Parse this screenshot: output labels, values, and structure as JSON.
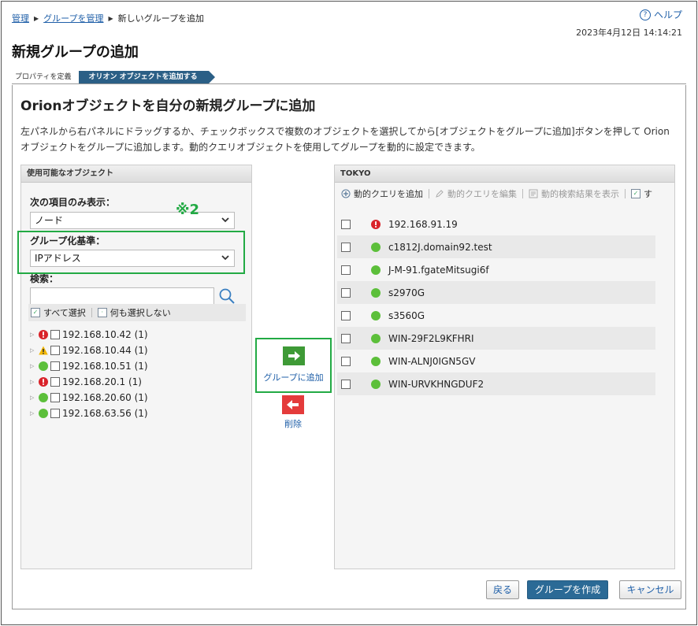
{
  "breadcrumb": {
    "item1": "管理",
    "item2": "グループを管理",
    "current": "新しいグループを追加"
  },
  "help_label": "ヘルプ",
  "timestamp": "2023年4月12日 14:14:21",
  "page_title": "新規グループの追加",
  "wizard": {
    "step1": "プロパティを定義",
    "step2": "オリオン オブジェクトを追加する"
  },
  "section_title": "Orionオブジェクトを自分の新規グループに追加",
  "description": "左パネルから右パネルにドラッグするか、チェックボックスで複数のオブジェクトを選択してから[オブジェクトをグループに追加]ボタンを押して Orionオブジェクトをグループに追加します。動的クエリオブジェクトを使用してグループを動的に設定できます。",
  "left_panel": {
    "header": "使用可能なオブジェクト",
    "show_only_label": "次の項目のみ表示：",
    "show_only_value": "ノード",
    "group_by_label": "グループ化基準：",
    "group_by_value": "IPアドレス",
    "search_label": "検索：",
    "select_all": "すべて選択",
    "select_none": "何も選択しない",
    "tree": [
      {
        "label": "192.168.10.42 (1)",
        "status": "error"
      },
      {
        "label": "192.168.10.44 (1)",
        "status": "warning"
      },
      {
        "label": "192.168.10.51 (1)",
        "status": "up"
      },
      {
        "label": "192.168.20.1 (1)",
        "status": "error"
      },
      {
        "label": "192.168.20.60 (1)",
        "status": "up"
      },
      {
        "label": "192.168.63.56 (1)",
        "status": "up"
      }
    ]
  },
  "annotation_mark": "※2",
  "add_button_label": "グループに追加",
  "delete_button_label": "削除",
  "right_panel": {
    "header": "TOKYO",
    "add_query": "動的クエリを追加",
    "edit_query": "動的クエリを編集",
    "show_results": "動的検索結果を表示",
    "trailing": "す",
    "items": [
      {
        "label": "192.168.91.19",
        "status": "error"
      },
      {
        "label": "c1812J.domain92.test",
        "status": "up"
      },
      {
        "label": "J-M-91.fgateMitsugi6f",
        "status": "up"
      },
      {
        "label": "s2970G",
        "status": "up"
      },
      {
        "label": "s3560G",
        "status": "up"
      },
      {
        "label": "WIN-29F2L9KFHRI",
        "status": "up"
      },
      {
        "label": "WIN-ALNJ0IGN5GV",
        "status": "up"
      },
      {
        "label": "WIN-URVKHNGDUF2",
        "status": "up"
      }
    ]
  },
  "footer": {
    "back": "戻る",
    "create": "グループを作成",
    "cancel": "キャンセル"
  },
  "colors": {
    "accent": "#2b6a96",
    "highlight": "#22aa44",
    "status_up": "#5cbf3a",
    "status_error": "#d9232a",
    "status_warning": "#f2b705"
  }
}
